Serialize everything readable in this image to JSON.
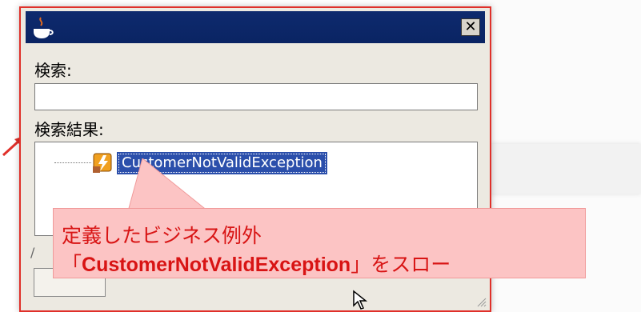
{
  "dialog": {
    "search_label": "検索:",
    "search_value": "",
    "results_label": "検索結果:",
    "close_glyph": "✕",
    "bottom_hint": "/"
  },
  "results": [
    {
      "label": "CustomerNotValidException"
    }
  ],
  "callout": {
    "line1": "定義したビジネス例外",
    "line2_open": "「",
    "line2_bold": "CustomerNotValidException",
    "line2_rest": "」をスロー"
  },
  "colors": {
    "titlebar": "#0a2463",
    "selection": "#2b4fab",
    "callout_bg": "#fcc4c4",
    "callout_text": "#d81414",
    "dialog_border": "#e0302a"
  }
}
